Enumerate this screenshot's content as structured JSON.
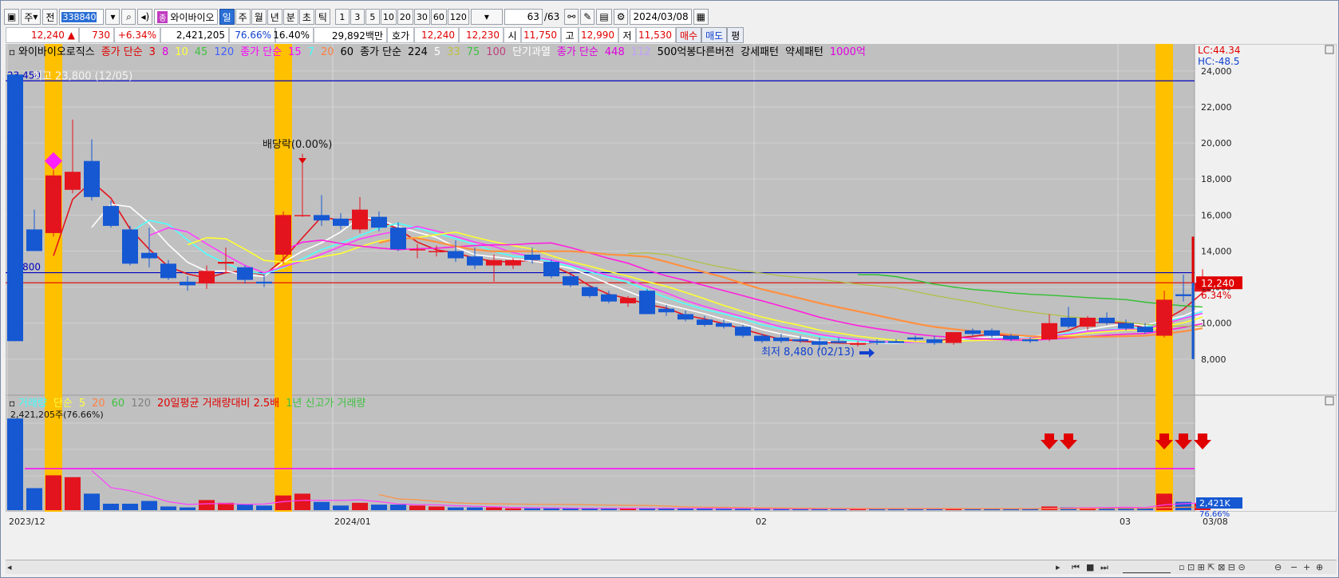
{
  "toolbar": {
    "period_label": "주",
    "prev_label": "전",
    "code": "338840",
    "name": "와이바이오",
    "name_badge": "종",
    "periods": [
      "일",
      "주",
      "월",
      "년",
      "분",
      "초",
      "틱"
    ],
    "selected_period": "일",
    "minute_options": [
      "1",
      "3",
      "5",
      "10",
      "20",
      "30",
      "60",
      "120"
    ],
    "count": "63",
    "count_total": "/63",
    "date": "2024/03/08"
  },
  "quote": {
    "price": "12,240",
    "change": "730",
    "change_pct": "+6.34%",
    "volume": "2,421,205",
    "vol_ratio": "76.66%",
    "turnover_pct": "16.40%",
    "amount": "29,892백만",
    "hoga_label": "호가",
    "ask": "12,240",
    "bid": "12,230",
    "open_label": "시",
    "open": "11,750",
    "high_label": "고",
    "high": "12,990",
    "low_label": "저",
    "low": "11,530",
    "buy_label": "매수",
    "sell_label": "매도",
    "avg_label": "평"
  },
  "colors": {
    "bg": "#c0c0c0",
    "up": "#e4141e",
    "down": "#1558d2",
    "highlight": "#ffc000"
  },
  "chart_data": {
    "type": "candlestick",
    "price_legend": [
      {
        "text": "와이바이오로직스",
        "color": "#000000"
      },
      {
        "text": "종가 단순",
        "color": "#e00000"
      },
      {
        "text": "3",
        "color": "#e00000"
      },
      {
        "text": "8",
        "color": "#e000e0"
      },
      {
        "text": "10",
        "color": "#ffff40"
      },
      {
        "text": "45",
        "color": "#40c040"
      },
      {
        "text": "120",
        "color": "#4060ff"
      },
      {
        "text": "종가 단순",
        "color": "#ff00ff"
      },
      {
        "text": "15",
        "color": "#ff00ff"
      },
      {
        "text": "7",
        "color": "#40ffff"
      },
      {
        "text": "20",
        "color": "#ff8040"
      },
      {
        "text": "60",
        "color": "#000000"
      },
      {
        "text": "종가 단순",
        "color": "#000000"
      },
      {
        "text": "224",
        "color": "#000000"
      },
      {
        "text": "5",
        "color": "#ffffff"
      },
      {
        "text": "33",
        "color": "#c0c040"
      },
      {
        "text": "75",
        "color": "#40c040"
      },
      {
        "text": "100",
        "color": "#c04080"
      },
      {
        "text": "단기과열",
        "color": "#ffffff"
      },
      {
        "text": "종가 단순",
        "color": "#e000e0"
      },
      {
        "text": "448",
        "color": "#e000e0"
      },
      {
        "text": "112",
        "color": "#c0a0ff"
      },
      {
        "text": "500억봉다른버전",
        "color": "#000000"
      },
      {
        "text": "강세패턴",
        "color": "#000000"
      },
      {
        "text": "약세패턴",
        "color": "#000000"
      },
      {
        "text": "1000억",
        "color": "#e000e0"
      }
    ],
    "volume_legend": [
      {
        "text": "거래량",
        "color": "#40ffff"
      },
      {
        "text": "단순",
        "color": "#ffff40"
      },
      {
        "text": "5",
        "color": "#ffff40"
      },
      {
        "text": "20",
        "color": "#ff8040"
      },
      {
        "text": "60",
        "color": "#40c040"
      },
      {
        "text": "120",
        "color": "#808080"
      },
      {
        "text": "20일평균 거래량대비 2.5배",
        "color": "#e00000"
      },
      {
        "text": "1년 신고가 거래량",
        "color": "#40c040"
      }
    ],
    "volume_readout": "2,421,205주(76.66%)",
    "y_axis_ticks": [
      "24,000",
      "22,000",
      "20,000",
      "18,000",
      "16,000",
      "14,000",
      "12,000",
      "10,000",
      "8,000"
    ],
    "y_axis_values": [
      24000,
      22000,
      20000,
      18000,
      16000,
      14000,
      12000,
      10000,
      8000
    ],
    "ylim": [
      6000,
      25500
    ],
    "x_axis_labels": [
      {
        "index": 0,
        "text": "2023/12"
      },
      {
        "index": 17,
        "text": "2024/01"
      },
      {
        "index": 39,
        "text": "02"
      },
      {
        "index": 58,
        "text": "03"
      }
    ],
    "x_axis_last_label": "03/08",
    "lc_label": "LC:44.34",
    "hc_label": "HC:-48.5",
    "current_price_label": "12,240",
    "current_pct_label": "6.34%",
    "volume_axis_label": "2,421K",
    "volume_axis_pct": "76.66%",
    "hlines": [
      {
        "value": 23450,
        "label": "23,450",
        "color": "#0000c0"
      },
      {
        "value": 12800,
        "label": "12,800",
        "color": "#0000c0"
      },
      {
        "value": 12240,
        "label": "",
        "color": "#e00000"
      }
    ],
    "annotations": {
      "high_label": "최고 23,800 (12/05)",
      "high_value": 23800,
      "low_label": "최저 8,480 (02/13)",
      "low_value": 8480,
      "low_index": 39,
      "dividend_label": "배당락(0.00%)",
      "dividend_index": 15
    },
    "highlight_indices": [
      2,
      14,
      60
    ],
    "signal_arrow_indices": [
      54,
      55,
      60,
      61,
      62
    ],
    "candles": [
      {
        "o": 23800,
        "h": 23800,
        "l": 9000,
        "c": 9000
      },
      {
        "o": 15200,
        "h": 16300,
        "l": 14000,
        "c": 14000
      },
      {
        "o": 15000,
        "h": 18500,
        "l": 14800,
        "c": 18200
      },
      {
        "o": 17400,
        "h": 21300,
        "l": 17200,
        "c": 18400
      },
      {
        "o": 19000,
        "h": 20200,
        "l": 16800,
        "c": 17000
      },
      {
        "o": 16500,
        "h": 16800,
        "l": 15300,
        "c": 15400
      },
      {
        "o": 15200,
        "h": 15400,
        "l": 13200,
        "c": 13300
      },
      {
        "o": 13900,
        "h": 15300,
        "l": 13100,
        "c": 13600
      },
      {
        "o": 13300,
        "h": 13500,
        "l": 12400,
        "c": 12500
      },
      {
        "o": 12300,
        "h": 12600,
        "l": 11800,
        "c": 12100
      },
      {
        "o": 12200,
        "h": 13200,
        "l": 11900,
        "c": 12900
      },
      {
        "o": 13300,
        "h": 14200,
        "l": 12800,
        "c": 13400
      },
      {
        "o": 13100,
        "h": 13200,
        "l": 12200,
        "c": 12400
      },
      {
        "o": 12300,
        "h": 12700,
        "l": 12000,
        "c": 12200
      },
      {
        "o": 13800,
        "h": 16200,
        "l": 13300,
        "c": 16000
      },
      {
        "o": 16000,
        "h": 19400,
        "l": 15900,
        "c": 16000
      },
      {
        "o": 16000,
        "h": 17100,
        "l": 15400,
        "c": 15700
      },
      {
        "o": 15800,
        "h": 16100,
        "l": 15200,
        "c": 15400
      },
      {
        "o": 15200,
        "h": 17000,
        "l": 15000,
        "c": 16300
      },
      {
        "o": 15900,
        "h": 16200,
        "l": 15100,
        "c": 15300
      },
      {
        "o": 15300,
        "h": 15600,
        "l": 14000,
        "c": 14100
      },
      {
        "o": 14100,
        "h": 14400,
        "l": 13600,
        "c": 14100
      },
      {
        "o": 14000,
        "h": 14300,
        "l": 13700,
        "c": 14000
      },
      {
        "o": 14000,
        "h": 14600,
        "l": 13400,
        "c": 13600
      },
      {
        "o": 13700,
        "h": 14200,
        "l": 13000,
        "c": 13200
      },
      {
        "o": 13200,
        "h": 13800,
        "l": 12300,
        "c": 13500
      },
      {
        "o": 13200,
        "h": 13600,
        "l": 13000,
        "c": 13500
      },
      {
        "o": 13800,
        "h": 14200,
        "l": 13300,
        "c": 13500
      },
      {
        "o": 13400,
        "h": 13500,
        "l": 12500,
        "c": 12600
      },
      {
        "o": 12600,
        "h": 12700,
        "l": 12000,
        "c": 12100
      },
      {
        "o": 12000,
        "h": 12100,
        "l": 11400,
        "c": 11500
      },
      {
        "o": 11600,
        "h": 11800,
        "l": 11100,
        "c": 11200
      },
      {
        "o": 11100,
        "h": 11500,
        "l": 10900,
        "c": 11400
      },
      {
        "o": 11800,
        "h": 11900,
        "l": 10500,
        "c": 10500
      },
      {
        "o": 10800,
        "h": 11000,
        "l": 10400,
        "c": 10600
      },
      {
        "o": 10500,
        "h": 10700,
        "l": 10100,
        "c": 10200
      },
      {
        "o": 10200,
        "h": 10400,
        "l": 9800,
        "c": 9900
      },
      {
        "o": 10000,
        "h": 10200,
        "l": 9700,
        "c": 9800
      },
      {
        "o": 9800,
        "h": 9900,
        "l": 9200,
        "c": 9300
      },
      {
        "o": 9300,
        "h": 9400,
        "l": 8900,
        "c": 9000
      },
      {
        "o": 9200,
        "h": 9400,
        "l": 8900,
        "c": 9000
      },
      {
        "o": 9100,
        "h": 9300,
        "l": 8900,
        "c": 9000
      },
      {
        "o": 9000,
        "h": 9200,
        "l": 8480,
        "c": 8800
      },
      {
        "o": 9000,
        "h": 9200,
        "l": 8900,
        "c": 8900
      },
      {
        "o": 8800,
        "h": 9000,
        "l": 8700,
        "c": 8900
      },
      {
        "o": 9000,
        "h": 9100,
        "l": 8800,
        "c": 8900
      },
      {
        "o": 9000,
        "h": 9100,
        "l": 8900,
        "c": 8900
      },
      {
        "o": 9200,
        "h": 9300,
        "l": 9000,
        "c": 9100
      },
      {
        "o": 9100,
        "h": 9300,
        "l": 8800,
        "c": 8900
      },
      {
        "o": 8900,
        "h": 9500,
        "l": 8800,
        "c": 9500
      },
      {
        "o": 9600,
        "h": 9700,
        "l": 9300,
        "c": 9400
      },
      {
        "o": 9600,
        "h": 9700,
        "l": 9200,
        "c": 9300
      },
      {
        "o": 9300,
        "h": 9400,
        "l": 9000,
        "c": 9100
      },
      {
        "o": 9100,
        "h": 9200,
        "l": 8900,
        "c": 9000
      },
      {
        "o": 9100,
        "h": 10500,
        "l": 9000,
        "c": 10000
      },
      {
        "o": 10300,
        "h": 10900,
        "l": 9700,
        "c": 9800
      },
      {
        "o": 9800,
        "h": 10400,
        "l": 9600,
        "c": 10300
      },
      {
        "o": 10300,
        "h": 10600,
        "l": 9900,
        "c": 10000
      },
      {
        "o": 10000,
        "h": 10200,
        "l": 9600,
        "c": 9700
      },
      {
        "o": 9800,
        "h": 10000,
        "l": 9400,
        "c": 9500
      },
      {
        "o": 9300,
        "h": 11800,
        "l": 9200,
        "c": 11300
      },
      {
        "o": 11600,
        "h": 12700,
        "l": 11200,
        "c": 11500
      },
      {
        "o": 11750,
        "h": 12990,
        "l": 11530,
        "c": 12240
      }
    ],
    "volumes": [
      100,
      24,
      38,
      36,
      18,
      7,
      7,
      10,
      4,
      3,
      11,
      8,
      6,
      5,
      16,
      18,
      9,
      5,
      8,
      6,
      6,
      5,
      4,
      3,
      3,
      3,
      2,
      2,
      2,
      2,
      2,
      2,
      2,
      2,
      2,
      2,
      2,
      1.5,
      1.5,
      1.5,
      1.5,
      1.5,
      1.5,
      1.5,
      1.5,
      1.5,
      1.5,
      1.5,
      1.5,
      2,
      1.5,
      1.5,
      1.5,
      1.5,
      4,
      3,
      3,
      3,
      2.5,
      2.5,
      18,
      9,
      7
    ]
  }
}
